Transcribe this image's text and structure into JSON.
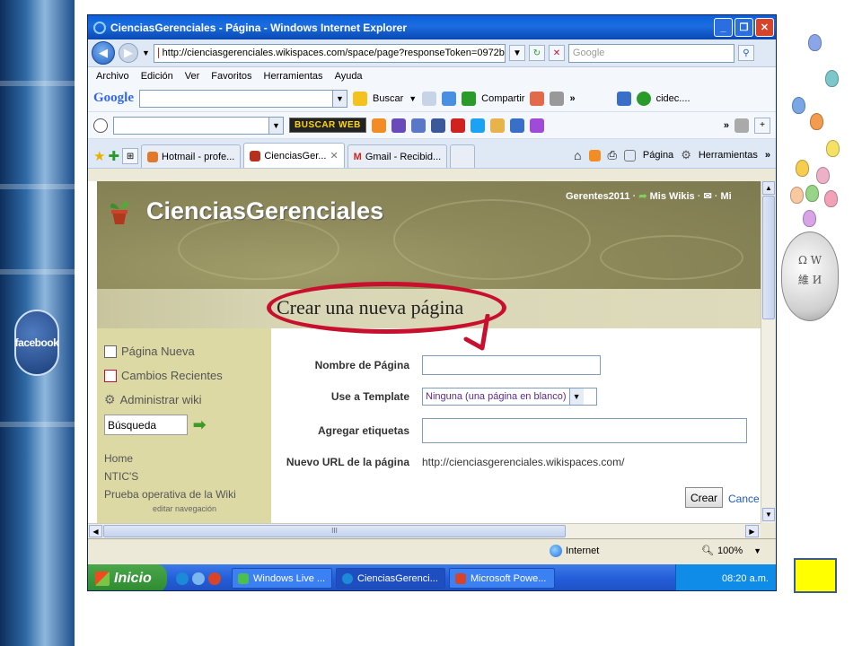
{
  "slide": {
    "facebook_label": "facebook",
    "globe_glyphs": [
      "Ω",
      "W",
      "И",
      "維"
    ]
  },
  "window": {
    "title": "CienciasGerenciales - Página - Windows Internet Explorer",
    "url": "http://cienciasgerenciales.wikispaces.com/space/page?responseToken=0972b",
    "search_placeholder": "Google",
    "menu": [
      "Archivo",
      "Edición",
      "Ver",
      "Favoritos",
      "Herramientas",
      "Ayuda"
    ]
  },
  "google_toolbar": {
    "logo": "Google",
    "buscar": "Buscar",
    "compartir": "Compartir",
    "user": "cidec...."
  },
  "toolbar2": {
    "buscaweb": "BUSCAR WEB"
  },
  "tabs": [
    {
      "label": "Hotmail - profe...",
      "active": false
    },
    {
      "label": "CienciasGer...",
      "active": true
    },
    {
      "label": "Gmail - Recibid...",
      "active": false
    }
  ],
  "tab_tools": {
    "pagina": "Página",
    "herramientas": "Herramientas"
  },
  "page": {
    "site_title": "CienciasGerenciales",
    "user": "Gerentes2011",
    "mis_wikis": "Mis Wikis",
    "mi": "Mi",
    "heading": "Crear una nueva página",
    "sidebar": {
      "items": [
        "Página Nueva",
        "Cambios Recientes",
        "Administrar wiki"
      ],
      "search_value": "Búsqueda",
      "links": [
        "Home",
        "NTIC'S",
        "Prueba operativa de la Wiki"
      ],
      "edit_nav": "editar navegación"
    },
    "form": {
      "name_label": "Nombre de Página",
      "name_value": "",
      "template_label": "Use a Template",
      "template_value": "Ninguna (una página en blanco)",
      "tags_label": "Agregar etiquetas",
      "tags_value": "",
      "url_label": "Nuevo URL de la página",
      "url_value": "http://cienciasgerenciales.wikispaces.com/",
      "create_button": "Crear",
      "cancel_link": "Cance"
    }
  },
  "statusbar": {
    "zone": "Internet",
    "zoom": "100%",
    "scroll_glyph": "III"
  },
  "taskbar": {
    "start": "Inicio",
    "tasks": [
      {
        "label": "Windows Live ...",
        "active": false
      },
      {
        "label": "CienciasGerenci...",
        "active": true
      },
      {
        "label": "Microsoft Powe...",
        "active": false
      }
    ],
    "clock": "08:20 a.m."
  },
  "colors": {
    "accent_red": "#c8102e",
    "slide_square": "#ffff00",
    "banner": "#8e8a5b",
    "sidebar": "#dcd9a4"
  }
}
